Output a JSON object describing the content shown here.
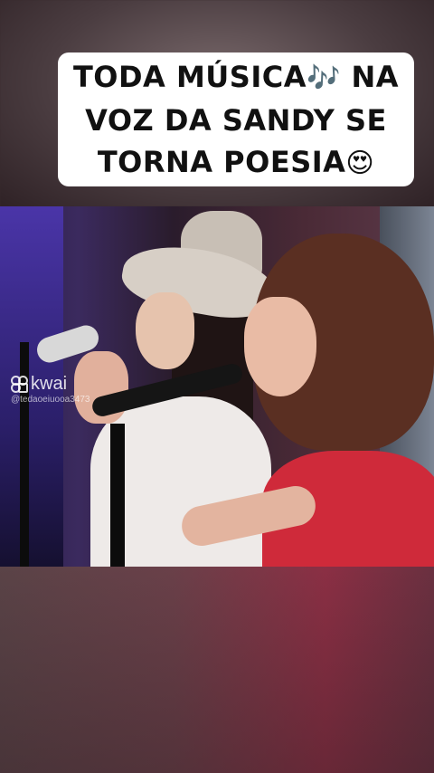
{
  "caption": {
    "line1": "TODA MÚSICA",
    "line1_emoji": "🎶",
    "line1_end": " NA",
    "line2": "VOZ DA SANDY SE",
    "line3": "TORNA POESIA",
    "line3_emoji": "😍"
  },
  "watermark": {
    "brand": "kwai",
    "handle": "@tedaoeiuooa3473",
    "icon": "kwai-logo-icon"
  },
  "colors": {
    "caption_bg": "#ffffff",
    "caption_text": "#111111",
    "accent_red": "#cf2a3a"
  }
}
